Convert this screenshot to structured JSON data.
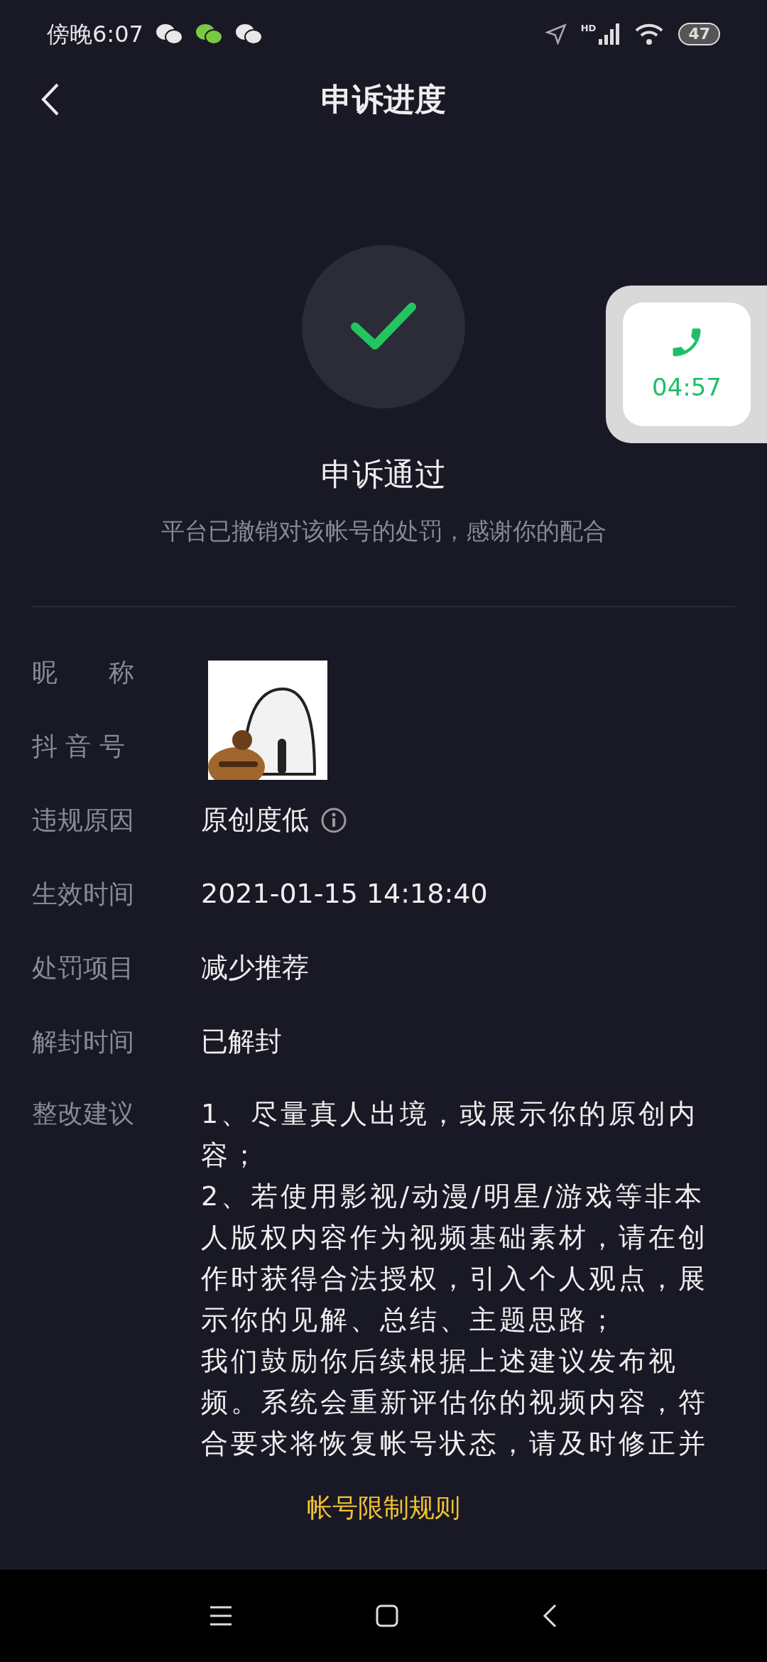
{
  "status_bar": {
    "time": "傍晚6:07",
    "notifications": [
      {
        "kind": "chat",
        "color": "#e8e8e8"
      },
      {
        "kind": "chat",
        "color": "#7ac943"
      },
      {
        "kind": "chat",
        "color": "#e8e8e8"
      }
    ],
    "network": "HD",
    "battery": "47"
  },
  "header": {
    "title": "申诉进度"
  },
  "result": {
    "passed": true,
    "title": "申诉通过",
    "subtitle": "平台已撤销对该帐号的处罚，感谢你的配合"
  },
  "call_widget": {
    "time": "04:57"
  },
  "details": [
    {
      "label": "昵　　称"
    },
    {
      "label": "抖 音 号"
    },
    {
      "label": "违规原因",
      "value": "原创度低",
      "info": true
    },
    {
      "label": "生效时间",
      "value": "2021-01-15 14:18:40",
      "info": false
    },
    {
      "label": "处罚项目",
      "value": "减少推荐",
      "info": false
    },
    {
      "label": "解封时间",
      "value": "已解封",
      "info": false
    }
  ],
  "suggestions": {
    "label": "整改建议",
    "paragraphs": [
      "1、尽量真人出境，或展示你的原创内容；",
      "2、若使用影视/动漫/明星/游戏等非本人版权内容作为视频基础素材，请在创作时获得合法授权，引入个人观点，展示你的见解、总结、主题思路；",
      "我们鼓励你后续根据上述建议发布视频。系统会重新评估你的视频内容，符合要求将恢复帐号状态，请及时修正并"
    ]
  },
  "link": "帐号限制规则"
}
